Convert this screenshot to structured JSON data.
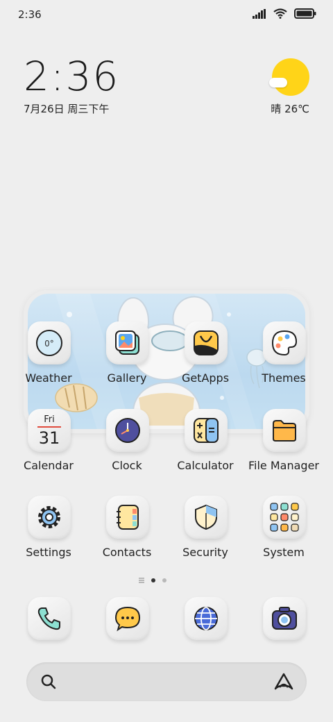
{
  "status_bar": {
    "time": "2:36",
    "icons": [
      "signal-icon",
      "wifi-icon",
      "battery-icon"
    ]
  },
  "clock_widget": {
    "time": "2:36",
    "date": "7月26日 周三下午"
  },
  "weather_widget": {
    "text": "晴 26℃",
    "icon": "sun-cloud-icon"
  },
  "apps_row1": [
    {
      "label": "Weather",
      "icon": "weather-icon"
    },
    {
      "label": "Gallery",
      "icon": "gallery-icon"
    },
    {
      "label": "GetApps",
      "icon": "getapps-icon"
    },
    {
      "label": "Themes",
      "icon": "themes-icon"
    }
  ],
  "apps_row2": [
    {
      "label": "Calendar",
      "icon": "calendar-icon",
      "day_name": "Fri",
      "day_number": "31"
    },
    {
      "label": "Clock",
      "icon": "clock-icon"
    },
    {
      "label": "Calculator",
      "icon": "calculator-icon"
    },
    {
      "label": "File Manager",
      "icon": "folder-icon"
    }
  ],
  "apps_row3": [
    {
      "label": "Settings",
      "icon": "settings-icon"
    },
    {
      "label": "Contacts",
      "icon": "contacts-icon"
    },
    {
      "label": "Security",
      "icon": "security-icon"
    },
    {
      "label": "System",
      "icon": "system-folder-icon"
    }
  ],
  "weather_app_badge": "0°",
  "page_indicator": {
    "pages": 2,
    "active": 1
  },
  "dock": [
    {
      "name": "Phone",
      "icon": "phone-icon"
    },
    {
      "name": "Messages",
      "icon": "messages-icon"
    },
    {
      "name": "Browser",
      "icon": "browser-icon"
    },
    {
      "name": "Camera",
      "icon": "camera-icon"
    }
  ],
  "search_bar": {
    "left_icon": "search-icon",
    "right_icon": "assistant-icon"
  },
  "colors": {
    "background": "#eeeeee",
    "sun": "#ffd418",
    "accent_blue": "#4a6bd8",
    "accent_yellow": "#ffc94a"
  }
}
